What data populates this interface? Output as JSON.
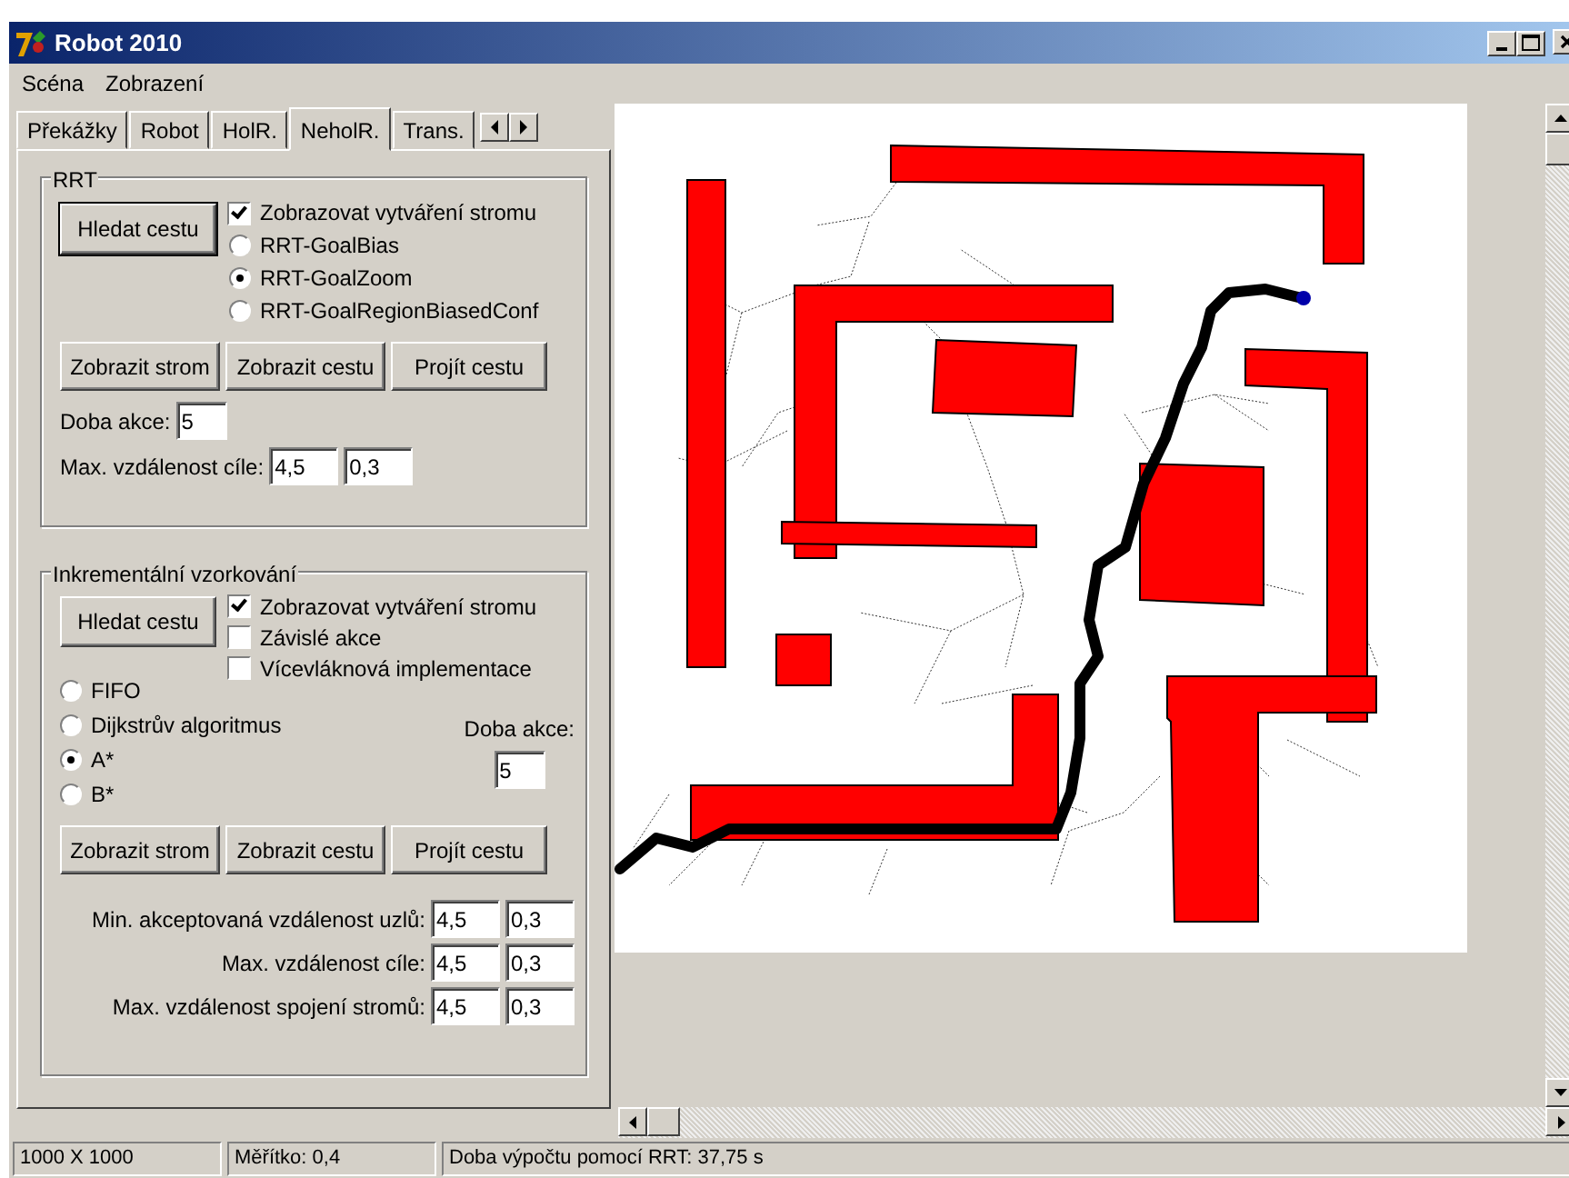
{
  "window": {
    "title": "Robot 2010"
  },
  "menu": [
    "Scéna",
    "Zobrazení"
  ],
  "tabs": [
    {
      "label": "Překážky",
      "selected": false
    },
    {
      "label": "Robot",
      "selected": false
    },
    {
      "label": "HolR.",
      "selected": false
    },
    {
      "label": "NeholR.",
      "selected": true
    },
    {
      "label": "Trans.",
      "selected": false
    }
  ],
  "rrt": {
    "title": "RRT",
    "find_button": "Hledat cestu",
    "checkboxes": [
      {
        "label": "Zobrazovat vytváření stromu",
        "checked": true
      }
    ],
    "radios": [
      {
        "label": "RRT-GoalBias",
        "selected": false
      },
      {
        "label": "RRT-GoalZoom",
        "selected": true
      },
      {
        "label": "RRT-GoalRegionBiasedConf",
        "selected": false
      }
    ],
    "buttons": [
      "Zobrazit strom",
      "Zobrazit cestu",
      "Projít cestu"
    ],
    "action_time": {
      "label": "Doba akce:",
      "value": "5"
    },
    "goal_distance": {
      "label": "Max. vzdálenost cíle:",
      "values": [
        "4,5",
        "0,3"
      ]
    }
  },
  "incremental": {
    "title": "Inkrementální vzorkování",
    "find_button": "Hledat cestu",
    "checkboxes": [
      {
        "label": "Zobrazovat vytváření stromu",
        "checked": true
      },
      {
        "label": "Závislé akce",
        "checked": false
      },
      {
        "label": "Vícevláknová implementace",
        "checked": false
      }
    ],
    "radios": [
      {
        "label": "FIFO",
        "selected": false
      },
      {
        "label": "Dijkstrův algoritmus",
        "selected": false
      },
      {
        "label": "A*",
        "selected": true
      },
      {
        "label": "B*",
        "selected": false
      }
    ],
    "action_time": {
      "label": "Doba akce:",
      "value": "5"
    },
    "buttons": [
      "Zobrazit strom",
      "Zobrazit cestu",
      "Projít cestu"
    ],
    "distances": [
      {
        "label": "Min. akceptovaná vzdálenost uzlů:",
        "values": [
          "4,5",
          "0,3"
        ]
      },
      {
        "label": "Max. vzdálenost cíle:",
        "values": [
          "4,5",
          "0,3"
        ]
      },
      {
        "label": "Max. vzdálenost spojení stromů:",
        "values": [
          "4,5",
          "0,3"
        ]
      }
    ]
  },
  "status_bar": [
    "1000 X 1000",
    "Měřítko: 0,4",
    "Doba výpočtu pomocí RRT: 37,75 s"
  ]
}
